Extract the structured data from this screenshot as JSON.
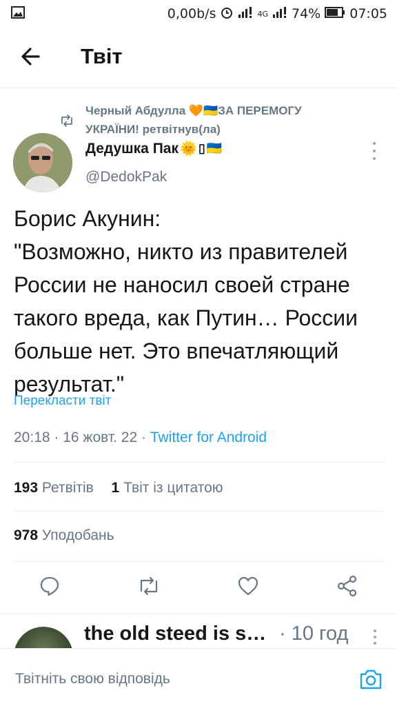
{
  "status_bar": {
    "speed": "0,00b/s",
    "network": "4G",
    "battery": "74%",
    "time": "07:05",
    "icons": [
      "gallery-icon",
      "alarm-icon",
      "signal-icon",
      "battery-icon"
    ]
  },
  "header": {
    "title": "Твіт",
    "back_icon": "arrow-left-icon"
  },
  "retweet": {
    "text": "Черный Абдулла 🧡🇺🇦ЗА ПЕРЕМОГУ УКРАЇНИ! ретвітнув(ла)"
  },
  "author": {
    "name": "Дедушка Пак",
    "name_emoji": "🌞",
    "flag_emoji": "🇺🇦",
    "handle": "@DedokPak"
  },
  "tweet": {
    "text": "Борис Акунин:\n\"Возможно, никто из правителей России не наносил своей стране такого вреда, как Путин… России больше нет. Это впечатляющий результат.\"",
    "translate_label": "Перекласти твіт",
    "time": "20:18",
    "date": "16 жовт. 22",
    "source": "Twitter for Android"
  },
  "stats": {
    "retweets_count": "193",
    "retweets_label": "Ретвітів",
    "quotes_count": "1",
    "quotes_label": "Твіт із цитатою",
    "likes_count": "978",
    "likes_label": "Уподобань"
  },
  "actions": [
    "reply-icon",
    "retweet-icon",
    "like-icon",
    "share-icon"
  ],
  "reply_preview": {
    "name": "the old steed is s…",
    "time": "· 10 год"
  },
  "compose": {
    "placeholder": "Твітніть свою відповідь"
  },
  "colors": {
    "accent": "#1da1f2",
    "secondary_text": "#657786",
    "divider": "#e6ecf0"
  }
}
